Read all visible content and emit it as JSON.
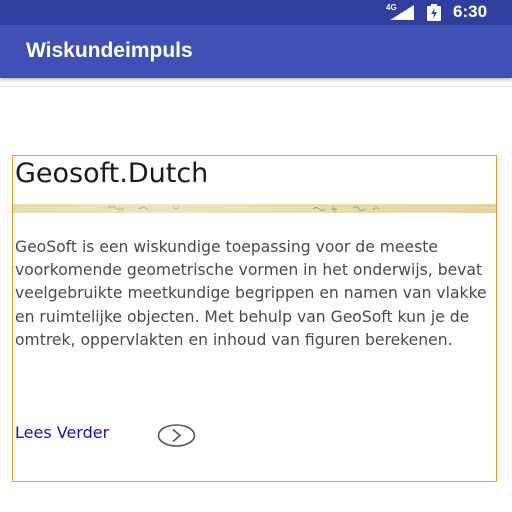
{
  "status_bar": {
    "network": "4G",
    "time": "6:30",
    "icons": [
      "signal-icon",
      "battery-icon"
    ]
  },
  "app_bar": {
    "title": "Wiskundeimpuls"
  },
  "card": {
    "title": "Geosoft.Dutch",
    "body": "GeoSoft is een wiskundige toepassing voor de meeste voorkomende geometrische vormen in het onderwijs, bevat veelgebruikte meetkundige begrippen en namen van vlakke en ruimtelijke objecten. Met behulp van GeoSoft kun je de omtrek, oppervlakten en inhoud van figuren berekenen.",
    "link_label": "Lees Verder",
    "link_icon": "chevron-right-circle-icon"
  },
  "colors": {
    "status_bar": "#303f9f",
    "app_bar": "#3f51b5",
    "card_border": "#f0962a",
    "link": "#1a12b4",
    "body_text": "#4a4a4a"
  }
}
